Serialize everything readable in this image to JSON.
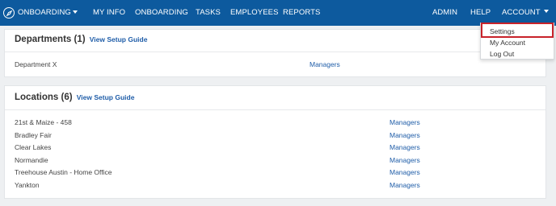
{
  "nav": {
    "brand_label": "ONBOARDING",
    "items": [
      {
        "label": "MY INFO"
      },
      {
        "label": "ONBOARDING"
      },
      {
        "label": "TASKS"
      },
      {
        "label": "EMPLOYEES"
      },
      {
        "label": "REPORTS"
      }
    ],
    "right_items": [
      {
        "label": "ADMIN"
      },
      {
        "label": "HELP"
      }
    ],
    "account_label": "ACCOUNT"
  },
  "account_menu": {
    "items": [
      {
        "label": "Settings"
      },
      {
        "label": "My Account"
      },
      {
        "label": "Log Out"
      }
    ],
    "highlighted": "Settings"
  },
  "departments": {
    "title": "Departments",
    "count": "(1)",
    "guide_link": "View Setup Guide",
    "rows": [
      {
        "name": "Department X",
        "link": "Managers"
      }
    ]
  },
  "locations": {
    "title": "Locations",
    "count": "(6)",
    "guide_link": "View Setup Guide",
    "rows": [
      {
        "name": "21st & Maize - 458",
        "link": "Managers"
      },
      {
        "name": "Bradley Fair",
        "link": "Managers"
      },
      {
        "name": "Clear Lakes",
        "link": "Managers"
      },
      {
        "name": "Normandie",
        "link": "Managers"
      },
      {
        "name": "Treehouse Austin - Home Office",
        "link": "Managers"
      },
      {
        "name": "Yankton",
        "link": "Managers"
      }
    ]
  },
  "colors": {
    "nav_background": "#0d5a9e",
    "link": "#1f5da8",
    "highlight_border": "#c8222a",
    "page_background": "#eef0f2"
  },
  "icons": {
    "brand": "compass-logo-icon",
    "dropdown": "caret-down-icon"
  }
}
